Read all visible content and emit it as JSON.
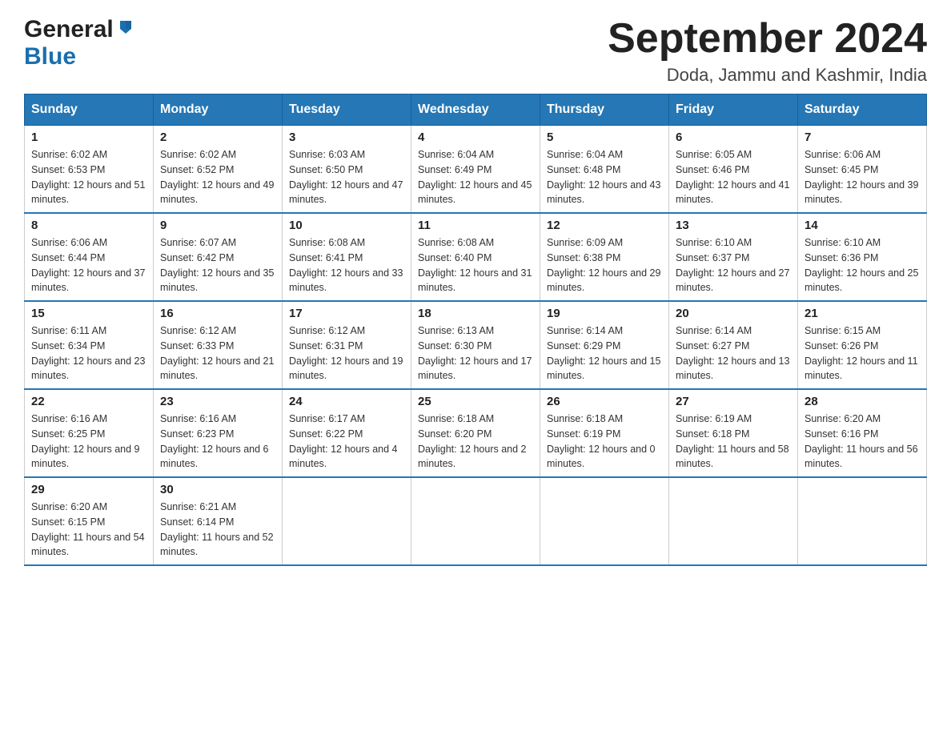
{
  "header": {
    "title": "September 2024",
    "subtitle": "Doda, Jammu and Kashmir, India",
    "logo_general": "General",
    "logo_blue": "Blue"
  },
  "weekdays": [
    "Sunday",
    "Monday",
    "Tuesday",
    "Wednesday",
    "Thursday",
    "Friday",
    "Saturday"
  ],
  "weeks": [
    [
      {
        "day": "1",
        "sunrise": "6:02 AM",
        "sunset": "6:53 PM",
        "daylight": "12 hours and 51 minutes."
      },
      {
        "day": "2",
        "sunrise": "6:02 AM",
        "sunset": "6:52 PM",
        "daylight": "12 hours and 49 minutes."
      },
      {
        "day": "3",
        "sunrise": "6:03 AM",
        "sunset": "6:50 PM",
        "daylight": "12 hours and 47 minutes."
      },
      {
        "day": "4",
        "sunrise": "6:04 AM",
        "sunset": "6:49 PM",
        "daylight": "12 hours and 45 minutes."
      },
      {
        "day": "5",
        "sunrise": "6:04 AM",
        "sunset": "6:48 PM",
        "daylight": "12 hours and 43 minutes."
      },
      {
        "day": "6",
        "sunrise": "6:05 AM",
        "sunset": "6:46 PM",
        "daylight": "12 hours and 41 minutes."
      },
      {
        "day": "7",
        "sunrise": "6:06 AM",
        "sunset": "6:45 PM",
        "daylight": "12 hours and 39 minutes."
      }
    ],
    [
      {
        "day": "8",
        "sunrise": "6:06 AM",
        "sunset": "6:44 PM",
        "daylight": "12 hours and 37 minutes."
      },
      {
        "day": "9",
        "sunrise": "6:07 AM",
        "sunset": "6:42 PM",
        "daylight": "12 hours and 35 minutes."
      },
      {
        "day": "10",
        "sunrise": "6:08 AM",
        "sunset": "6:41 PM",
        "daylight": "12 hours and 33 minutes."
      },
      {
        "day": "11",
        "sunrise": "6:08 AM",
        "sunset": "6:40 PM",
        "daylight": "12 hours and 31 minutes."
      },
      {
        "day": "12",
        "sunrise": "6:09 AM",
        "sunset": "6:38 PM",
        "daylight": "12 hours and 29 minutes."
      },
      {
        "day": "13",
        "sunrise": "6:10 AM",
        "sunset": "6:37 PM",
        "daylight": "12 hours and 27 minutes."
      },
      {
        "day": "14",
        "sunrise": "6:10 AM",
        "sunset": "6:36 PM",
        "daylight": "12 hours and 25 minutes."
      }
    ],
    [
      {
        "day": "15",
        "sunrise": "6:11 AM",
        "sunset": "6:34 PM",
        "daylight": "12 hours and 23 minutes."
      },
      {
        "day": "16",
        "sunrise": "6:12 AM",
        "sunset": "6:33 PM",
        "daylight": "12 hours and 21 minutes."
      },
      {
        "day": "17",
        "sunrise": "6:12 AM",
        "sunset": "6:31 PM",
        "daylight": "12 hours and 19 minutes."
      },
      {
        "day": "18",
        "sunrise": "6:13 AM",
        "sunset": "6:30 PM",
        "daylight": "12 hours and 17 minutes."
      },
      {
        "day": "19",
        "sunrise": "6:14 AM",
        "sunset": "6:29 PM",
        "daylight": "12 hours and 15 minutes."
      },
      {
        "day": "20",
        "sunrise": "6:14 AM",
        "sunset": "6:27 PM",
        "daylight": "12 hours and 13 minutes."
      },
      {
        "day": "21",
        "sunrise": "6:15 AM",
        "sunset": "6:26 PM",
        "daylight": "12 hours and 11 minutes."
      }
    ],
    [
      {
        "day": "22",
        "sunrise": "6:16 AM",
        "sunset": "6:25 PM",
        "daylight": "12 hours and 9 minutes."
      },
      {
        "day": "23",
        "sunrise": "6:16 AM",
        "sunset": "6:23 PM",
        "daylight": "12 hours and 6 minutes."
      },
      {
        "day": "24",
        "sunrise": "6:17 AM",
        "sunset": "6:22 PM",
        "daylight": "12 hours and 4 minutes."
      },
      {
        "day": "25",
        "sunrise": "6:18 AM",
        "sunset": "6:20 PM",
        "daylight": "12 hours and 2 minutes."
      },
      {
        "day": "26",
        "sunrise": "6:18 AM",
        "sunset": "6:19 PM",
        "daylight": "12 hours and 0 minutes."
      },
      {
        "day": "27",
        "sunrise": "6:19 AM",
        "sunset": "6:18 PM",
        "daylight": "11 hours and 58 minutes."
      },
      {
        "day": "28",
        "sunrise": "6:20 AM",
        "sunset": "6:16 PM",
        "daylight": "11 hours and 56 minutes."
      }
    ],
    [
      {
        "day": "29",
        "sunrise": "6:20 AM",
        "sunset": "6:15 PM",
        "daylight": "11 hours and 54 minutes."
      },
      {
        "day": "30",
        "sunrise": "6:21 AM",
        "sunset": "6:14 PM",
        "daylight": "11 hours and 52 minutes."
      },
      null,
      null,
      null,
      null,
      null
    ]
  ],
  "labels": {
    "sunrise": "Sunrise:",
    "sunset": "Sunset:",
    "daylight": "Daylight:"
  }
}
